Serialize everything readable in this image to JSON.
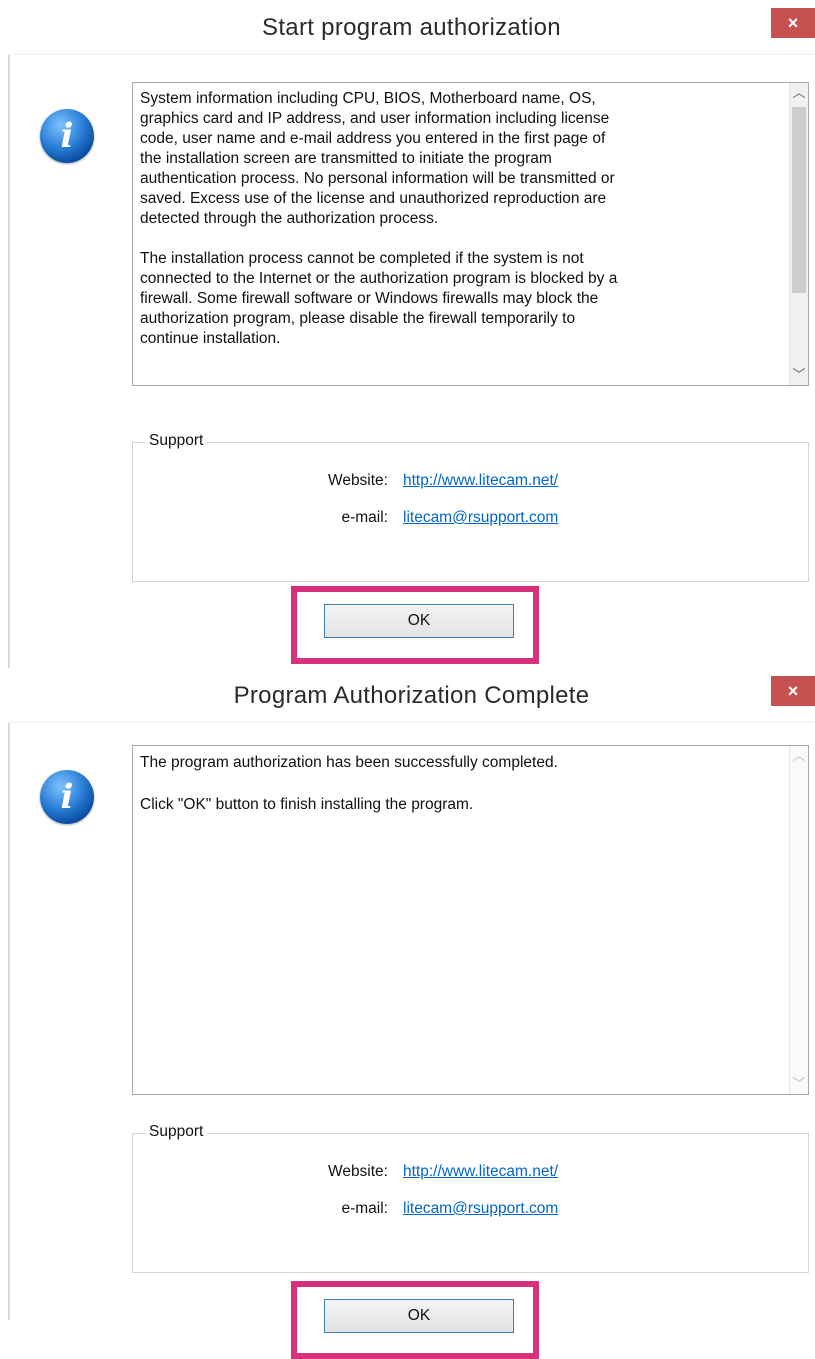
{
  "dialog1": {
    "title": "Start program authorization",
    "close_glyph": "×",
    "message": "System information including CPU, BIOS, Motherboard name, OS,\ngraphics card and IP address, and user information including license\ncode, user name and e-mail address you entered in the first page of\nthe installation screen are transmitted to initiate the program\nauthentication process. No personal information will be transmitted or\nsaved. Excess use of the license and unauthorized reproduction are\ndetected through the authorization process.\n\nThe installation process cannot be completed if the system is not\nconnected to the Internet or the authorization program is blocked by a\nfirewall. Some firewall software or Windows firewalls may block the\nauthorization program, please disable the firewall temporarily to\ncontinue installation.",
    "support": {
      "legend": "Support",
      "website_label": "Website:",
      "website_value": "http://www.litecam.net/",
      "email_label": "e-mail:",
      "email_value": "litecam@rsupport.com"
    },
    "ok_label": "OK"
  },
  "dialog2": {
    "title": "Program Authorization Complete",
    "close_glyph": "×",
    "message": "The program authorization has been successfully completed.\n\nClick \"OK\" button to finish installing the program.",
    "support": {
      "legend": "Support",
      "website_label": "Website:",
      "website_value": "http://www.litecam.net/",
      "email_label": "e-mail:",
      "email_value": "litecam@rsupport.com"
    },
    "ok_label": "OK"
  },
  "icons": {
    "info_glyph": "i",
    "scroll_up_glyph": "︿",
    "scroll_down_glyph": "﹀"
  },
  "colors": {
    "highlight": "#d6317a",
    "close_button": "#c75050",
    "link": "#0066cc"
  }
}
